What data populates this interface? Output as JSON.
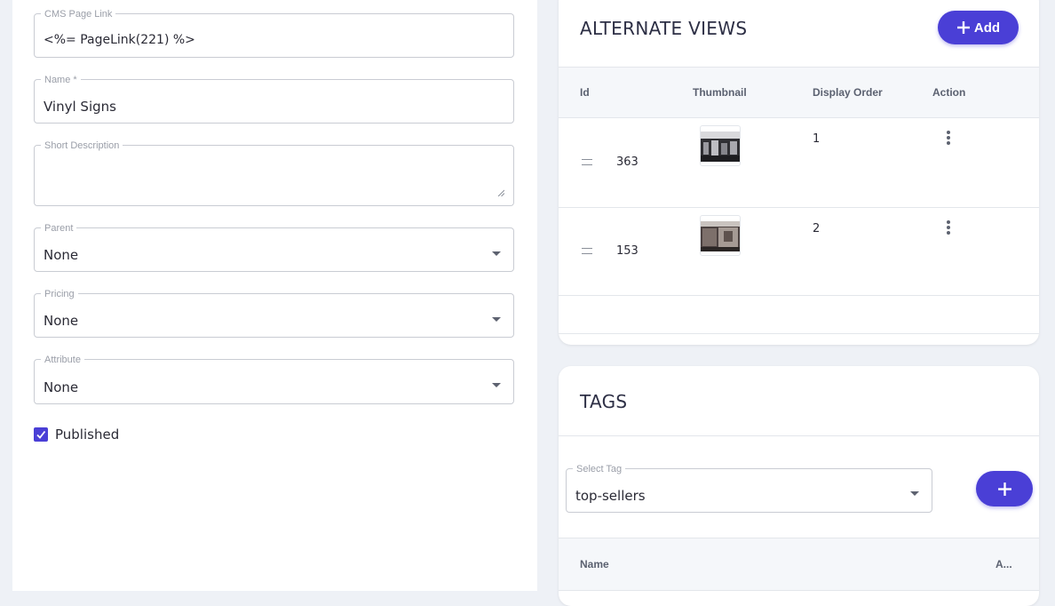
{
  "form": {
    "cms_page_link": {
      "label": "CMS Page Link",
      "value": "<%= PageLink(221) %>"
    },
    "name": {
      "label": "Name *",
      "value": "Vinyl Signs"
    },
    "short_description": {
      "label": "Short Description",
      "value": ""
    },
    "parent": {
      "label": "Parent",
      "value": "None"
    },
    "pricing": {
      "label": "Pricing",
      "value": "None"
    },
    "attribute": {
      "label": "Attribute",
      "value": "None"
    },
    "published": {
      "label": "Published",
      "checked": true
    }
  },
  "alternate_views": {
    "title": "ALTERNATE VIEWS",
    "add_label": "Add",
    "columns": [
      "Id",
      "Thumbnail",
      "Display Order",
      "Action"
    ],
    "rows": [
      {
        "id": "363",
        "display_order": "1"
      },
      {
        "id": "153",
        "display_order": "2"
      }
    ]
  },
  "tags": {
    "title": "TAGS",
    "select_label": "Select Tag",
    "select_value": "top-sellers",
    "columns": [
      "Name",
      "A..."
    ]
  },
  "colors": {
    "accent": "#4a3fd6",
    "background": "#eef1f6"
  }
}
